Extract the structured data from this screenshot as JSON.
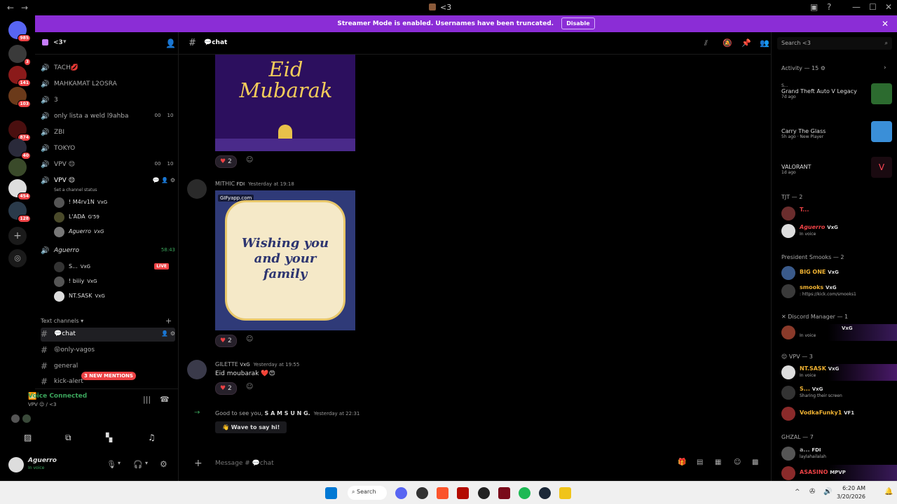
{
  "window": {
    "title": "<3"
  },
  "banner": {
    "text": "Streamer Mode is enabled. Usernames have been truncated.",
    "disable_label": "Disable"
  },
  "servers": {
    "badges": [
      "985",
      "3",
      "141",
      "103",
      "874",
      "40",
      "454",
      "128"
    ]
  },
  "guild": {
    "name": "<3"
  },
  "channels": [
    {
      "label": "TACH💋"
    },
    {
      "label": "MAHKAMAT L2OSRA"
    },
    {
      "label": "3"
    },
    {
      "label": "only lista a weld l9ahba",
      "counts": [
        "00",
        "10"
      ]
    },
    {
      "label": "ZBI"
    },
    {
      "label": "TOKYO"
    },
    {
      "label": "VPV 😌",
      "counts": [
        "00",
        "10"
      ]
    },
    {
      "label": "VPV 😌"
    }
  ],
  "channel_status": "Set a channel status",
  "vpv_users": [
    {
      "name": "! M4rv1N",
      "tag": "VxG"
    },
    {
      "name": "L'ADA",
      "tag": "G'59"
    },
    {
      "name": "Aguerro",
      "tag": "VxG"
    }
  ],
  "aguerro_channel": {
    "name": "Aguerro",
    "time": "58:43"
  },
  "aguerro_users": [
    {
      "name": "S...",
      "tag": "VxG",
      "live": "LIVE"
    },
    {
      "name": "! biiiy",
      "tag": "VxG"
    },
    {
      "name": "NT.SASK",
      "tag": "VxG"
    }
  ],
  "text_category": "Text channels",
  "text_channels": [
    {
      "label": "💬chat"
    },
    {
      "label": "😝only-vagos"
    },
    {
      "label": "general"
    },
    {
      "label": "kick-alert"
    }
  ],
  "new_mentions": "3 NEW MENTIONS",
  "voice": {
    "status": "Voice Connected",
    "location": "VPV 😌 / <3"
  },
  "user": {
    "name": "Aguerro",
    "status": "In voice"
  },
  "chat": {
    "channel_name": "💬chat",
    "messages": [
      {
        "author": "MITHIC",
        "tag": "FDI",
        "time": "Yesterday at 19:18",
        "gif_label": "GIF",
        "gif_source": "yapp.com",
        "card_text": "Wishing you and your family",
        "reaction_count": "2"
      },
      {
        "author": "GILETTE",
        "tag": "VxG",
        "time": "Yesterday at 19:55",
        "text": "Eid moubarak ❤️😍",
        "reaction_count": "2"
      }
    ],
    "image1_text": "Eid Mubarak",
    "image1_reaction": "2",
    "welcome": {
      "prefix": "Good to see you, ",
      "name": "S A M S U N G.",
      "time": "Yesterday at 22:31",
      "button": "Wave to say hi!"
    },
    "composer_placeholder": "Message # 💬chat"
  },
  "members": {
    "search_placeholder": "Search <3",
    "activity_header": "Activity — 15",
    "activities": [
      {
        "user": "S...",
        "game": "Grand Theft Auto V Legacy",
        "time": "7d ago",
        "color": "#2c6b2f"
      },
      {
        "user": "",
        "game": "Carry The Glass",
        "time": "5h ago",
        "extra": "New Player",
        "color": "#3a8fd8"
      },
      {
        "user": "",
        "game": "VALORANT",
        "time": "1d ago",
        "color": "#ff4655"
      }
    ],
    "groups": [
      {
        "header": "TJT — 2",
        "members": [
          {
            "name": "T...",
            "color": "#ed4245",
            "sub": ""
          },
          {
            "name": "Aguerro",
            "tag": "VxG",
            "sub": "In voice",
            "color": "#ed4245"
          }
        ]
      },
      {
        "header": "President Smooks — 2",
        "members": [
          {
            "name": "BIG ONE",
            "tag": "VxG",
            "color": "#f0b232",
            "sub": ""
          },
          {
            "name": "smooks",
            "tag": "VxG",
            "color": "#f0b232",
            "sub": ": https://kick.com/smooks1"
          }
        ]
      },
      {
        "header": "Discord Manager — 1",
        "members": [
          {
            "name": "",
            "tag": "VxG",
            "sub": "In voice",
            "color": "#c77dff"
          }
        ]
      },
      {
        "header": "VPV — 3",
        "members": [
          {
            "name": "NT.SASK",
            "tag": "VxG",
            "sub": "In voice",
            "color": "#f0b232"
          },
          {
            "name": "S...",
            "tag": "VxG",
            "sub": "Sharing their screen",
            "color": "#f0b232"
          },
          {
            "name": "VodkaFunky1",
            "tag": "VF1",
            "color": "#f0b232",
            "sub": ""
          }
        ]
      },
      {
        "header": "GHZAL — 7",
        "members": [
          {
            "name": "a...",
            "tag": "FDI",
            "sub": "laylahailalah",
            "color": "#aaa"
          },
          {
            "name": "ASASINO",
            "tag": "MPVP",
            "color": "#ed4245",
            "sub": ""
          }
        ]
      }
    ]
  },
  "taskbar": {
    "search": "Search",
    "time": "6:20 AM",
    "date": "3/20/2026"
  }
}
